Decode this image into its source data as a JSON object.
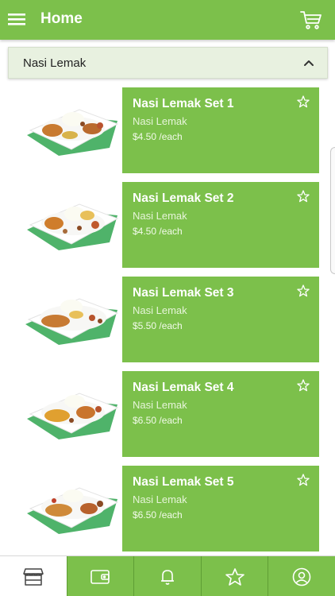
{
  "header": {
    "title": "Home",
    "menu_icon": "hamburger-menu-icon",
    "cart_icon": "cart-icon"
  },
  "category": {
    "title": "Nasi Lemak",
    "toggle_icon": "chevron-up-icon",
    "expanded": true
  },
  "items": [
    {
      "name": "Nasi Lemak Set 1",
      "category": "Nasi Lemak",
      "price": "$4.50 /each"
    },
    {
      "name": "Nasi Lemak Set 2",
      "category": "Nasi Lemak",
      "price": "$4.50 /each"
    },
    {
      "name": "Nasi Lemak Set 3",
      "category": "Nasi Lemak",
      "price": "$5.50 /each"
    },
    {
      "name": "Nasi Lemak Set 4",
      "category": "Nasi Lemak",
      "price": "$6.50 /each"
    },
    {
      "name": "Nasi Lemak Set 5",
      "category": "Nasi Lemak",
      "price": "$6.50 /each"
    }
  ],
  "bottom_nav": [
    {
      "icon": "store-icon",
      "active": true
    },
    {
      "icon": "wallet-icon",
      "active": false
    },
    {
      "icon": "bell-icon",
      "active": false
    },
    {
      "icon": "star-icon",
      "active": false
    },
    {
      "icon": "profile-icon",
      "active": false
    }
  ],
  "colors": {
    "primary": "#7cc04b",
    "category_bg": "#e8f1e0",
    "text_dark": "#222222"
  }
}
